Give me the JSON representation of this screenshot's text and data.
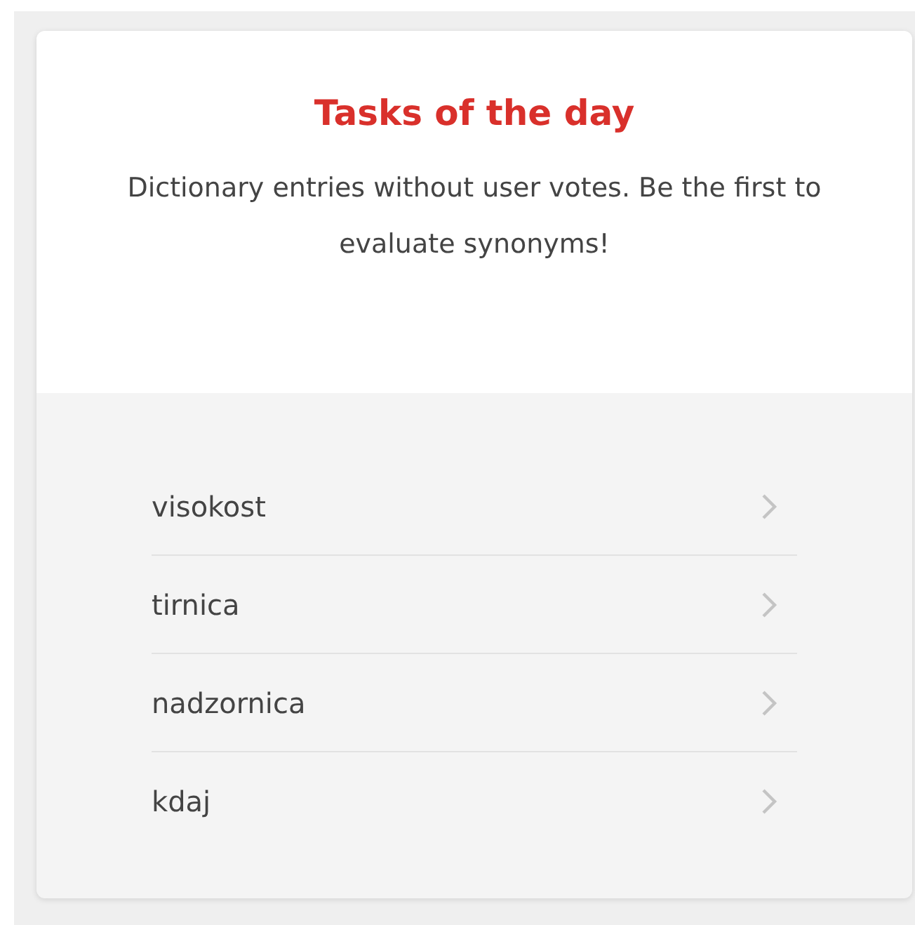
{
  "title": "Tasks of the day",
  "description": "Dictionary entries without user votes. Be the first to evaluate synonyms!",
  "entries": [
    {
      "word": "visokost"
    },
    {
      "word": "tirnica"
    },
    {
      "word": "nadzornica"
    },
    {
      "word": "kdaj"
    }
  ]
}
